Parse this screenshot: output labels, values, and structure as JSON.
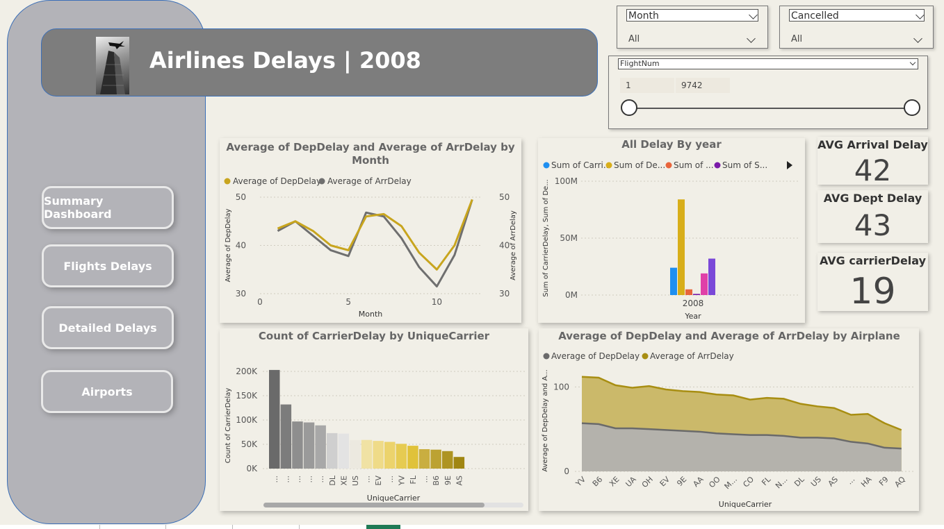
{
  "header": {
    "title": "Airlines Delays | 2008"
  },
  "nav": [
    {
      "label": "Summary Dashboard"
    },
    {
      "label": "Flights Delays"
    },
    {
      "label": "Detailed Delays"
    },
    {
      "label": "Airports"
    }
  ],
  "slicers": {
    "month": {
      "field": "Month",
      "value": "All"
    },
    "cancelled": {
      "field": "Cancelled",
      "value": "All"
    },
    "flightnum": {
      "field": "FlightNum",
      "min": "1",
      "max": "9742"
    }
  },
  "kpis": [
    {
      "label": "AVG Arrival Delay",
      "value": "42"
    },
    {
      "label": "AVG Dept Delay",
      "value": "43"
    },
    {
      "label": "AVG carrierDelay",
      "value": "19"
    }
  ],
  "colors": {
    "gold": "#c8a51e",
    "gray": "#6f6f6f",
    "accent": "#3b6fb8"
  },
  "chart_data": [
    {
      "type": "line",
      "title": "Average of DepDelay and Average of ArrDelay by Month",
      "xlabel": "Month",
      "ylabel": "Average of DepDelay",
      "y2label": "Average of ArrDelay",
      "x": [
        1,
        2,
        3,
        4,
        5,
        6,
        7,
        8,
        9,
        10,
        11,
        12
      ],
      "xticks": [
        "0",
        "5",
        "10"
      ],
      "yticks": [
        "30",
        "40",
        "50"
      ],
      "ylim": [
        30,
        50
      ],
      "xlim": [
        0,
        12.5
      ],
      "legend": "top-left",
      "series": [
        {
          "name": "Average of DepDelay",
          "color": "#c8a51e",
          "values": [
            43.5,
            45,
            43,
            40,
            39,
            46,
            46.5,
            44,
            38.5,
            35,
            40,
            49.5
          ]
        },
        {
          "name": "Average of ArrDelay",
          "color": "#6f6f6f",
          "values": [
            43,
            45,
            42,
            39,
            37.8,
            46.8,
            46,
            41.5,
            35.5,
            31.5,
            38,
            49.5
          ]
        }
      ]
    },
    {
      "type": "bar",
      "title": "All Delay By year",
      "xlabel": "Year",
      "ylabel": "Sum of CarrierDelay, Sum of De...",
      "categories": [
        "2008"
      ],
      "yticks": [
        "0M",
        "50M",
        "100M"
      ],
      "ylim": [
        0,
        100
      ],
      "legend": "top",
      "series": [
        {
          "name": "Sum of Carri...",
          "color": "#1f8ff0",
          "values": [
            24
          ]
        },
        {
          "name": "Sum of De...",
          "color": "#d8ae1a",
          "values": [
            84
          ]
        },
        {
          "name": "Sum of ...",
          "color": "#e8653c",
          "values": [
            5
          ]
        },
        {
          "name": "Sum of S...",
          "color": "#7a1aa8",
          "values": [
            1
          ]
        },
        {
          "name": "",
          "color": "#e040a8",
          "values": [
            19
          ]
        },
        {
          "name": "",
          "color": "#7a48d8",
          "values": [
            32
          ]
        }
      ]
    },
    {
      "type": "bar",
      "title": "Count of CarrierDelay by UniqueCarrier",
      "xlabel": "UniqueCarrier",
      "ylabel": "Count of CarrierDelay",
      "categories": [
        "...",
        "...",
        "...",
        "...",
        "...",
        "DL",
        "XE",
        "US",
        "...",
        "EV",
        "...",
        "YV",
        "FL",
        "...",
        "B6",
        "9E",
        "AS"
      ],
      "values": [
        203,
        132,
        97,
        95,
        89,
        73,
        72,
        59,
        59,
        57,
        55,
        51,
        47,
        40,
        39,
        36,
        24
      ],
      "colors": [
        "#6a6a6a",
        "#7c7c7c",
        "#8e8e8e",
        "#9a9a9a",
        "#a8a8a8",
        "#cfcfcf",
        "#e3e3e3",
        "#ece9e0",
        "#f0e2a4",
        "#efdb88",
        "#ecd36c",
        "#e6cb52",
        "#e0c23a",
        "#c9ae40",
        "#bca232",
        "#ae9422",
        "#a08612"
      ],
      "yticks": [
        "0K",
        "50K",
        "100K",
        "150K",
        "200K"
      ],
      "ylim": [
        0,
        200
      ]
    },
    {
      "type": "area",
      "title": "Average of DepDelay and Average of ArrDelay by Airplane",
      "xlabel": "UniqueCarrier",
      "ylabel": "Average of DepDelay and A...",
      "categories": [
        "YV",
        "B6",
        "XE",
        "UA",
        "OH",
        "EV",
        "9E",
        "AA",
        "OO",
        "M...",
        "CO",
        "FL",
        "N...",
        "DL",
        "US",
        "AS",
        "...",
        "HA",
        "F9",
        "AQ"
      ],
      "yticks": [
        "0",
        "100"
      ],
      "ylim": [
        0,
        120
      ],
      "legend": "top-left",
      "series": [
        {
          "name": "Average of DepDelay",
          "color": "#6a6a6a",
          "values": [
            57,
            56,
            51,
            51,
            50,
            49,
            48,
            47,
            45,
            44,
            43,
            43,
            42,
            40,
            40,
            39,
            35,
            33,
            28,
            27
          ]
        },
        {
          "name": "Average of ArrDelay",
          "color": "#a88e12",
          "values": [
            112,
            111,
            102,
            99,
            101,
            97,
            95,
            94,
            91,
            90,
            85,
            87,
            86,
            80,
            77,
            75,
            67,
            68,
            57,
            49
          ]
        }
      ]
    }
  ]
}
